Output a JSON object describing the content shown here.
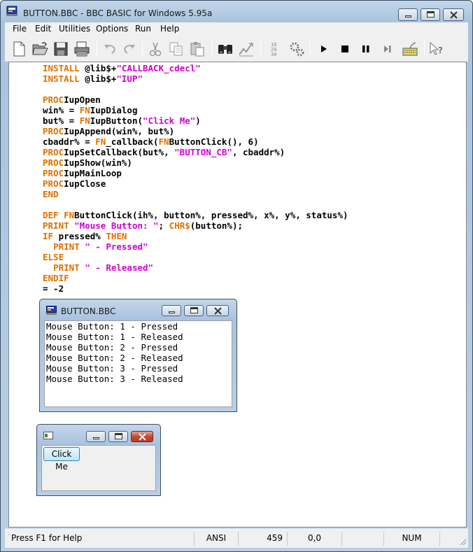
{
  "window": {
    "title": "BUTTON.BBC - BBC BASIC for Windows 5.95a"
  },
  "menu": [
    "File",
    "Edit",
    "Utilities",
    "Options",
    "Run",
    "Help"
  ],
  "toolbar": [
    "new-file-icon",
    "open-folder-icon",
    "save-icon",
    "print-icon",
    "undo-icon",
    "redo-icon",
    "cut-icon",
    "copy-icon",
    "paste-icon",
    "find-icon",
    "replace-icon",
    "renumber-icon",
    "compile-icon",
    "run-icon",
    "stop-icon",
    "pause-icon",
    "step-icon",
    "immediate-mode-icon",
    "context-help-icon"
  ],
  "code": [
    [
      [
        "k",
        "INSTALL "
      ],
      [
        "n",
        "@lib$+"
      ],
      [
        "s",
        "\"CALLBACK_cdecl\""
      ]
    ],
    [
      [
        "k",
        "INSTALL "
      ],
      [
        "n",
        "@lib$+"
      ],
      [
        "s",
        "\"IUP\""
      ]
    ],
    [],
    [
      [
        "k",
        "PROC"
      ],
      [
        "n",
        "IupOpen"
      ]
    ],
    [
      [
        "n",
        "win% = "
      ],
      [
        "k",
        "FN"
      ],
      [
        "n",
        "IupDialog"
      ]
    ],
    [
      [
        "n",
        "but% = "
      ],
      [
        "k",
        "FN"
      ],
      [
        "n",
        "IupButton("
      ],
      [
        "s",
        "\"Click Me\""
      ],
      [
        "n",
        ")"
      ]
    ],
    [
      [
        "k",
        "PROC"
      ],
      [
        "n",
        "IupAppend(win%, but%)"
      ]
    ],
    [
      [
        "n",
        "cbaddr% = "
      ],
      [
        "k",
        "FN"
      ],
      [
        "n",
        "_callback("
      ],
      [
        "k",
        "FN"
      ],
      [
        "n",
        "ButtonClick(), 6)"
      ]
    ],
    [
      [
        "k",
        "PROC"
      ],
      [
        "n",
        "IupSetCallback(but%, "
      ],
      [
        "s",
        "\"BUTTON_CB\""
      ],
      [
        "n",
        ", cbaddr%)"
      ]
    ],
    [
      [
        "k",
        "PROC"
      ],
      [
        "n",
        "IupShow(win%)"
      ]
    ],
    [
      [
        "k",
        "PROC"
      ],
      [
        "n",
        "IupMainLoop"
      ]
    ],
    [
      [
        "k",
        "PROC"
      ],
      [
        "n",
        "IupClose"
      ]
    ],
    [
      [
        "k",
        "END"
      ]
    ],
    [],
    [
      [
        "k",
        "DEF FN"
      ],
      [
        "n",
        "ButtonClick(ih%, button%, pressed%, x%, y%, status%)"
      ]
    ],
    [
      [
        "k",
        "PRINT "
      ],
      [
        "s",
        "\"Mouse Button: \""
      ],
      [
        "n",
        "; "
      ],
      [
        "k",
        "CHR$"
      ],
      [
        "n",
        "(button%);"
      ]
    ],
    [
      [
        "k",
        "IF "
      ],
      [
        "n",
        "pressed% "
      ],
      [
        "k",
        "THEN"
      ]
    ],
    [
      [
        "n",
        "  "
      ],
      [
        "k",
        "PRINT "
      ],
      [
        "s",
        "\" - Pressed\""
      ]
    ],
    [
      [
        "k",
        "ELSE"
      ]
    ],
    [
      [
        "n",
        "  "
      ],
      [
        "k",
        "PRINT "
      ],
      [
        "s",
        "\" - Released\""
      ]
    ],
    [
      [
        "k",
        "ENDIF"
      ]
    ],
    [
      [
        "n",
        "= -2"
      ]
    ]
  ],
  "output_window": {
    "title": "BUTTON.BBC",
    "lines": [
      "Mouse Button: 1 - Pressed",
      "Mouse Button: 1 - Released",
      "Mouse Button: 2 - Pressed",
      "Mouse Button: 2 - Released",
      "Mouse Button: 3 - Pressed",
      "Mouse Button: 3 - Released"
    ]
  },
  "dialog_window": {
    "button_label": "Click Me"
  },
  "status": {
    "help": "Press F1 for Help",
    "encoding": "ANSI",
    "size": "459",
    "position": "0,0",
    "num": "NUM"
  }
}
